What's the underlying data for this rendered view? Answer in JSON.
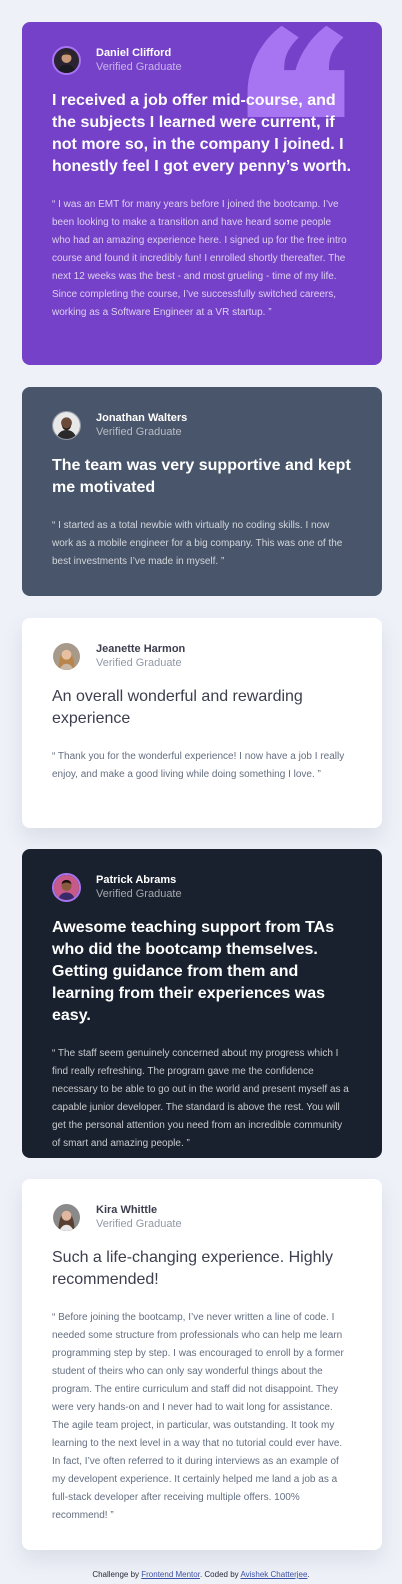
{
  "colors": {
    "page_bg": "#eef1f8",
    "purple": "#7541c8",
    "grey_blue": "#48556a",
    "white": "#ffffff",
    "dark_navy": "#19212e",
    "accent_light_purple": "#a775f1"
  },
  "testimonials": [
    {
      "name": "Daniel Clifford",
      "role": "Verified Graduate",
      "headline": "I received a job offer mid-course, and the subjects I learned were current, if not more so, in the company I joined. I honestly feel I got every penny’s worth.",
      "body": "“ I was an EMT for many years before I joined the bootcamp. I’ve been looking to make a transition and have heard some people who had an amazing experience here. I signed up for the free intro course and found it incredibly fun! I enrolled shortly thereafter. The next 12 weeks was the best - and most grueling - time of my life. Since completing the course, I’ve successfully switched careers, working as a Software Engineer at a VR startup. ”",
      "avatar_icon": "person-avatar-icon"
    },
    {
      "name": "Jonathan Walters",
      "role": "Verified Graduate",
      "headline": "The team was very supportive and kept me motivated",
      "body": "“ I started as a total newbie with virtually no coding skills. I now work as a mobile engineer for a big company. This was one of the best investments I’ve made in myself. ”",
      "avatar_icon": "person-avatar-icon"
    },
    {
      "name": "Jeanette Harmon",
      "role": "Verified Graduate",
      "headline": "An overall wonderful and rewarding experience",
      "body": "“ Thank you for the wonderful experience! I now have a job I really enjoy, and make a good living while doing something I love. ”",
      "avatar_icon": "person-avatar-icon"
    },
    {
      "name": "Patrick Abrams",
      "role": "Verified Graduate",
      "headline": "Awesome teaching support from TAs who did the bootcamp themselves. Getting guidance from them and learning from their experiences was easy.",
      "body": "“ The staff seem genuinely concerned about my progress which I find really refreshing. The program gave me the confidence necessary to be able to go out in the world and present myself as a capable junior developer. The standard is above the rest. You will get the personal attention you need from an incredible community of smart and amazing people. ”",
      "avatar_icon": "person-avatar-icon"
    },
    {
      "name": "Kira Whittle",
      "role": "Verified Graduate",
      "headline": "Such a life-changing experience. Highly recommended!",
      "body": "“ Before joining the bootcamp, I’ve never written a line of code. I needed some structure from professionals who can help me learn programming step by step. I was encouraged to enroll by a former student of theirs who can only say wonderful things about the program. The entire curriculum and staff did not disappoint. They were very hands-on and I never had to wait long for assistance. The agile team project, in particular, was outstanding. It took my learning to the next level in a way that no tutorial could ever have. In fact, I’ve often referred to it during interviews as an example of my developent experience. It certainly helped me land a job as a full-stack developer after receiving multiple offers. 100% recommend! ”",
      "avatar_icon": "person-avatar-icon"
    }
  ],
  "footer": {
    "prefix": "Challenge by ",
    "link1": "Frontend Mentor",
    "middle": ". Coded by ",
    "link2": "Avishek Chatterjee",
    "suffix": "."
  }
}
